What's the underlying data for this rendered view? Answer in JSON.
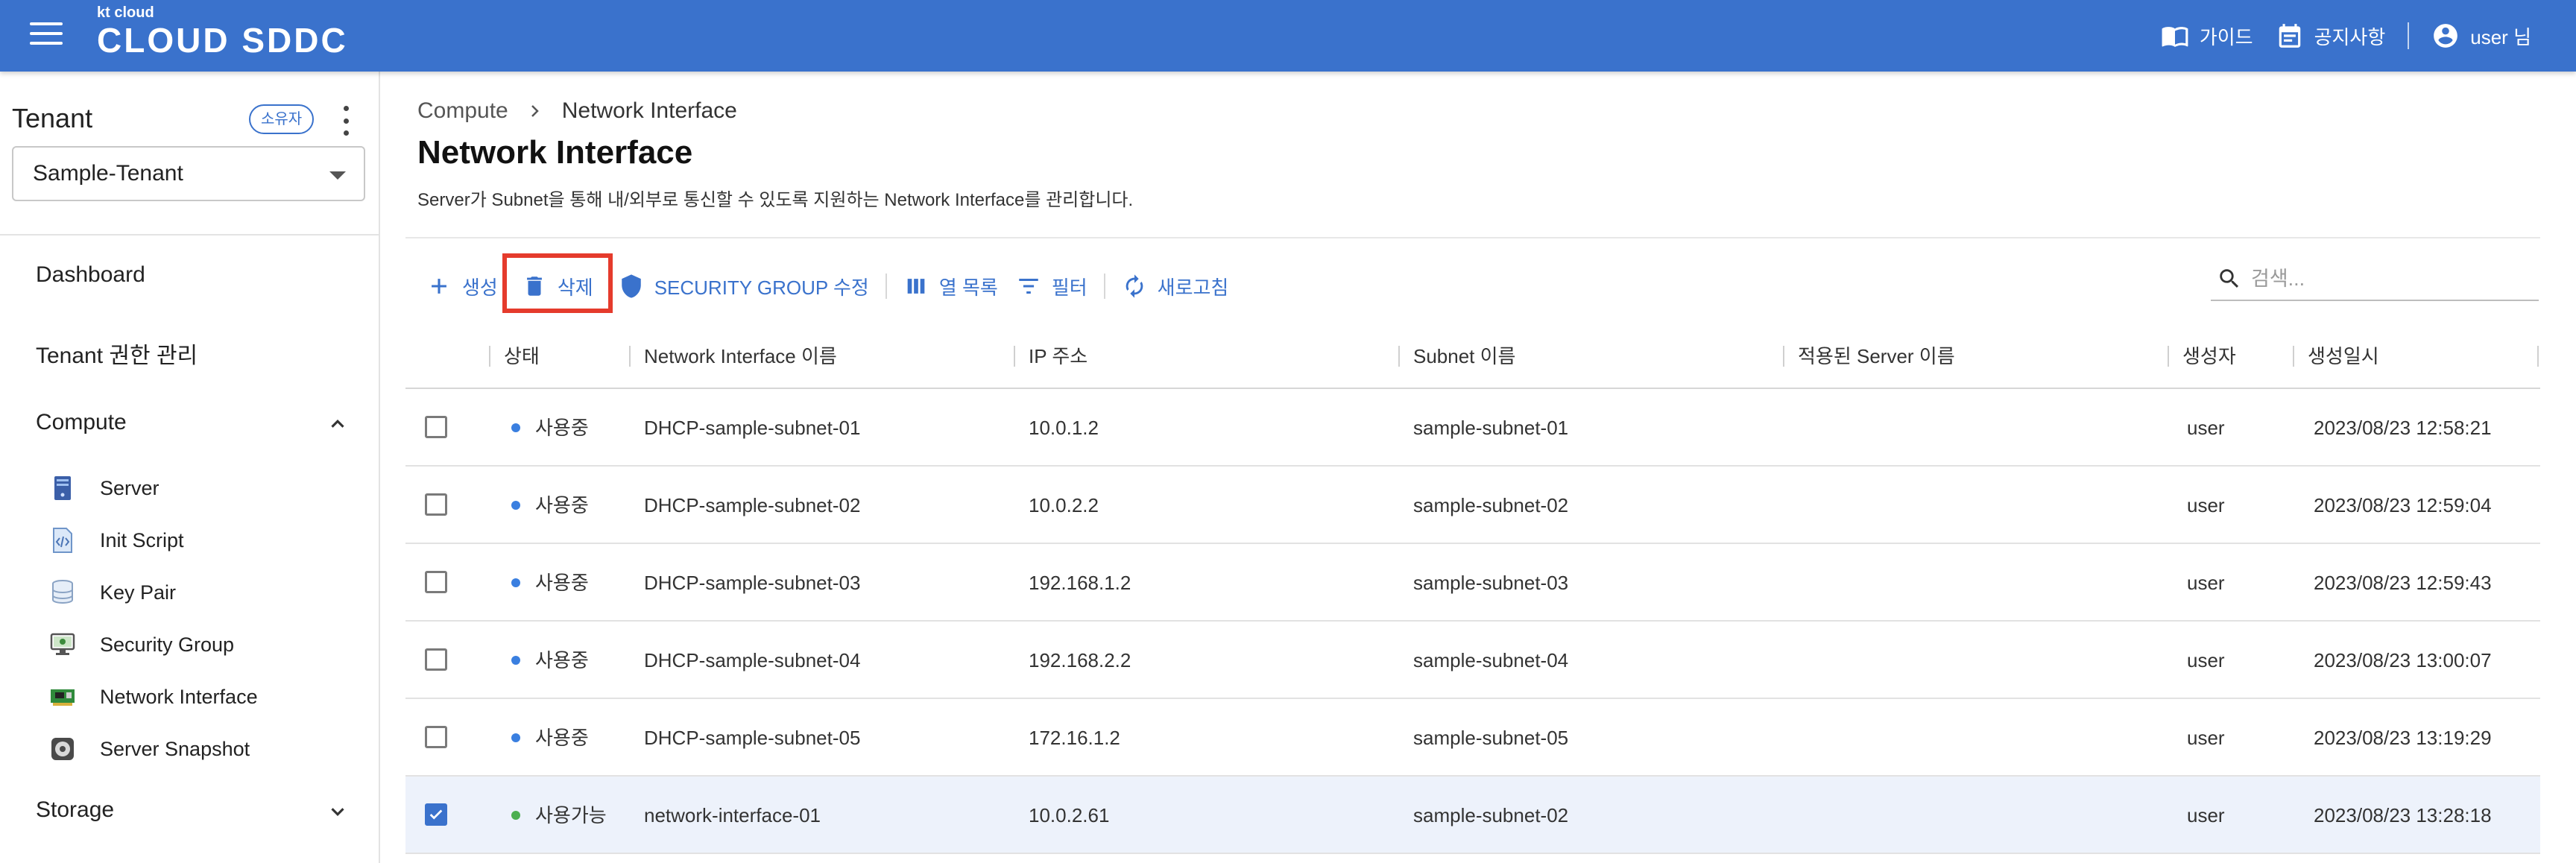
{
  "header": {
    "logo_small": "kt cloud",
    "logo_big": "CLOUD SDDC",
    "guide": "가이드",
    "notice": "공지사항",
    "user": "user 님",
    "bg_color": "#3a72cc"
  },
  "sidebar": {
    "tenant_title": "Tenant",
    "owner_badge": "소유자",
    "tenant_selected": "Sample-Tenant",
    "dashboard": "Dashboard",
    "tenant_perm": "Tenant 권한 관리",
    "compute": {
      "label": "Compute",
      "expanded": true,
      "items": [
        {
          "label": "Server",
          "icon": "server-icon"
        },
        {
          "label": "Init Script",
          "icon": "init-script-icon"
        },
        {
          "label": "Key Pair",
          "icon": "key-pair-icon"
        },
        {
          "label": "Security Group",
          "icon": "security-group-icon"
        },
        {
          "label": "Network Interface",
          "icon": "network-interface-icon"
        },
        {
          "label": "Server Snapshot",
          "icon": "server-snapshot-icon"
        }
      ]
    },
    "storage": {
      "label": "Storage",
      "expanded": false
    }
  },
  "main": {
    "breadcrumb": [
      "Compute",
      "Network Interface"
    ],
    "title": "Network Interface",
    "description": "Server가 Subnet을 통해 내/외부로 통신할 수 있도록 지원하는 Network Interface를 관리합니다.",
    "toolbar": {
      "create": "생성",
      "delete": "삭제",
      "security_group": "SECURITY GROUP 수정",
      "columns": "열 목록",
      "filter": "필터",
      "refresh": "새로고침"
    },
    "search_placeholder": "검색...",
    "accent_color": "#3a72cc",
    "highlight_color": "#e53b2c"
  },
  "table": {
    "columns": [
      "상태",
      "Network Interface 이름",
      "IP 주소",
      "Subnet 이름",
      "적용된 Server 이름",
      "생성자",
      "생성일시"
    ],
    "rows": [
      {
        "checked": false,
        "status": "사용중",
        "status_color": "#3a7fe0",
        "name": "DHCP-sample-subnet-01",
        "ip": "10.0.1.2",
        "subnet": "sample-subnet-01",
        "server": "",
        "creator": "user",
        "created": "2023/08/23 12:58:21"
      },
      {
        "checked": false,
        "status": "사용중",
        "status_color": "#3a7fe0",
        "name": "DHCP-sample-subnet-02",
        "ip": "10.0.2.2",
        "subnet": "sample-subnet-02",
        "server": "",
        "creator": "user",
        "created": "2023/08/23 12:59:04"
      },
      {
        "checked": false,
        "status": "사용중",
        "status_color": "#3a7fe0",
        "name": "DHCP-sample-subnet-03",
        "ip": "192.168.1.2",
        "subnet": "sample-subnet-03",
        "server": "",
        "creator": "user",
        "created": "2023/08/23 12:59:43"
      },
      {
        "checked": false,
        "status": "사용중",
        "status_color": "#3a7fe0",
        "name": "DHCP-sample-subnet-04",
        "ip": "192.168.2.2",
        "subnet": "sample-subnet-04",
        "server": "",
        "creator": "user",
        "created": "2023/08/23 13:00:07"
      },
      {
        "checked": false,
        "status": "사용중",
        "status_color": "#3a7fe0",
        "name": "DHCP-sample-subnet-05",
        "ip": "172.16.1.2",
        "subnet": "sample-subnet-05",
        "server": "",
        "creator": "user",
        "created": "2023/08/23 13:19:29"
      },
      {
        "checked": true,
        "status": "사용가능",
        "status_color": "#4caf50",
        "name": "network-interface-01",
        "ip": "10.0.2.61",
        "subnet": "sample-subnet-02",
        "server": "",
        "creator": "user",
        "created": "2023/08/23 13:28:18"
      }
    ]
  }
}
